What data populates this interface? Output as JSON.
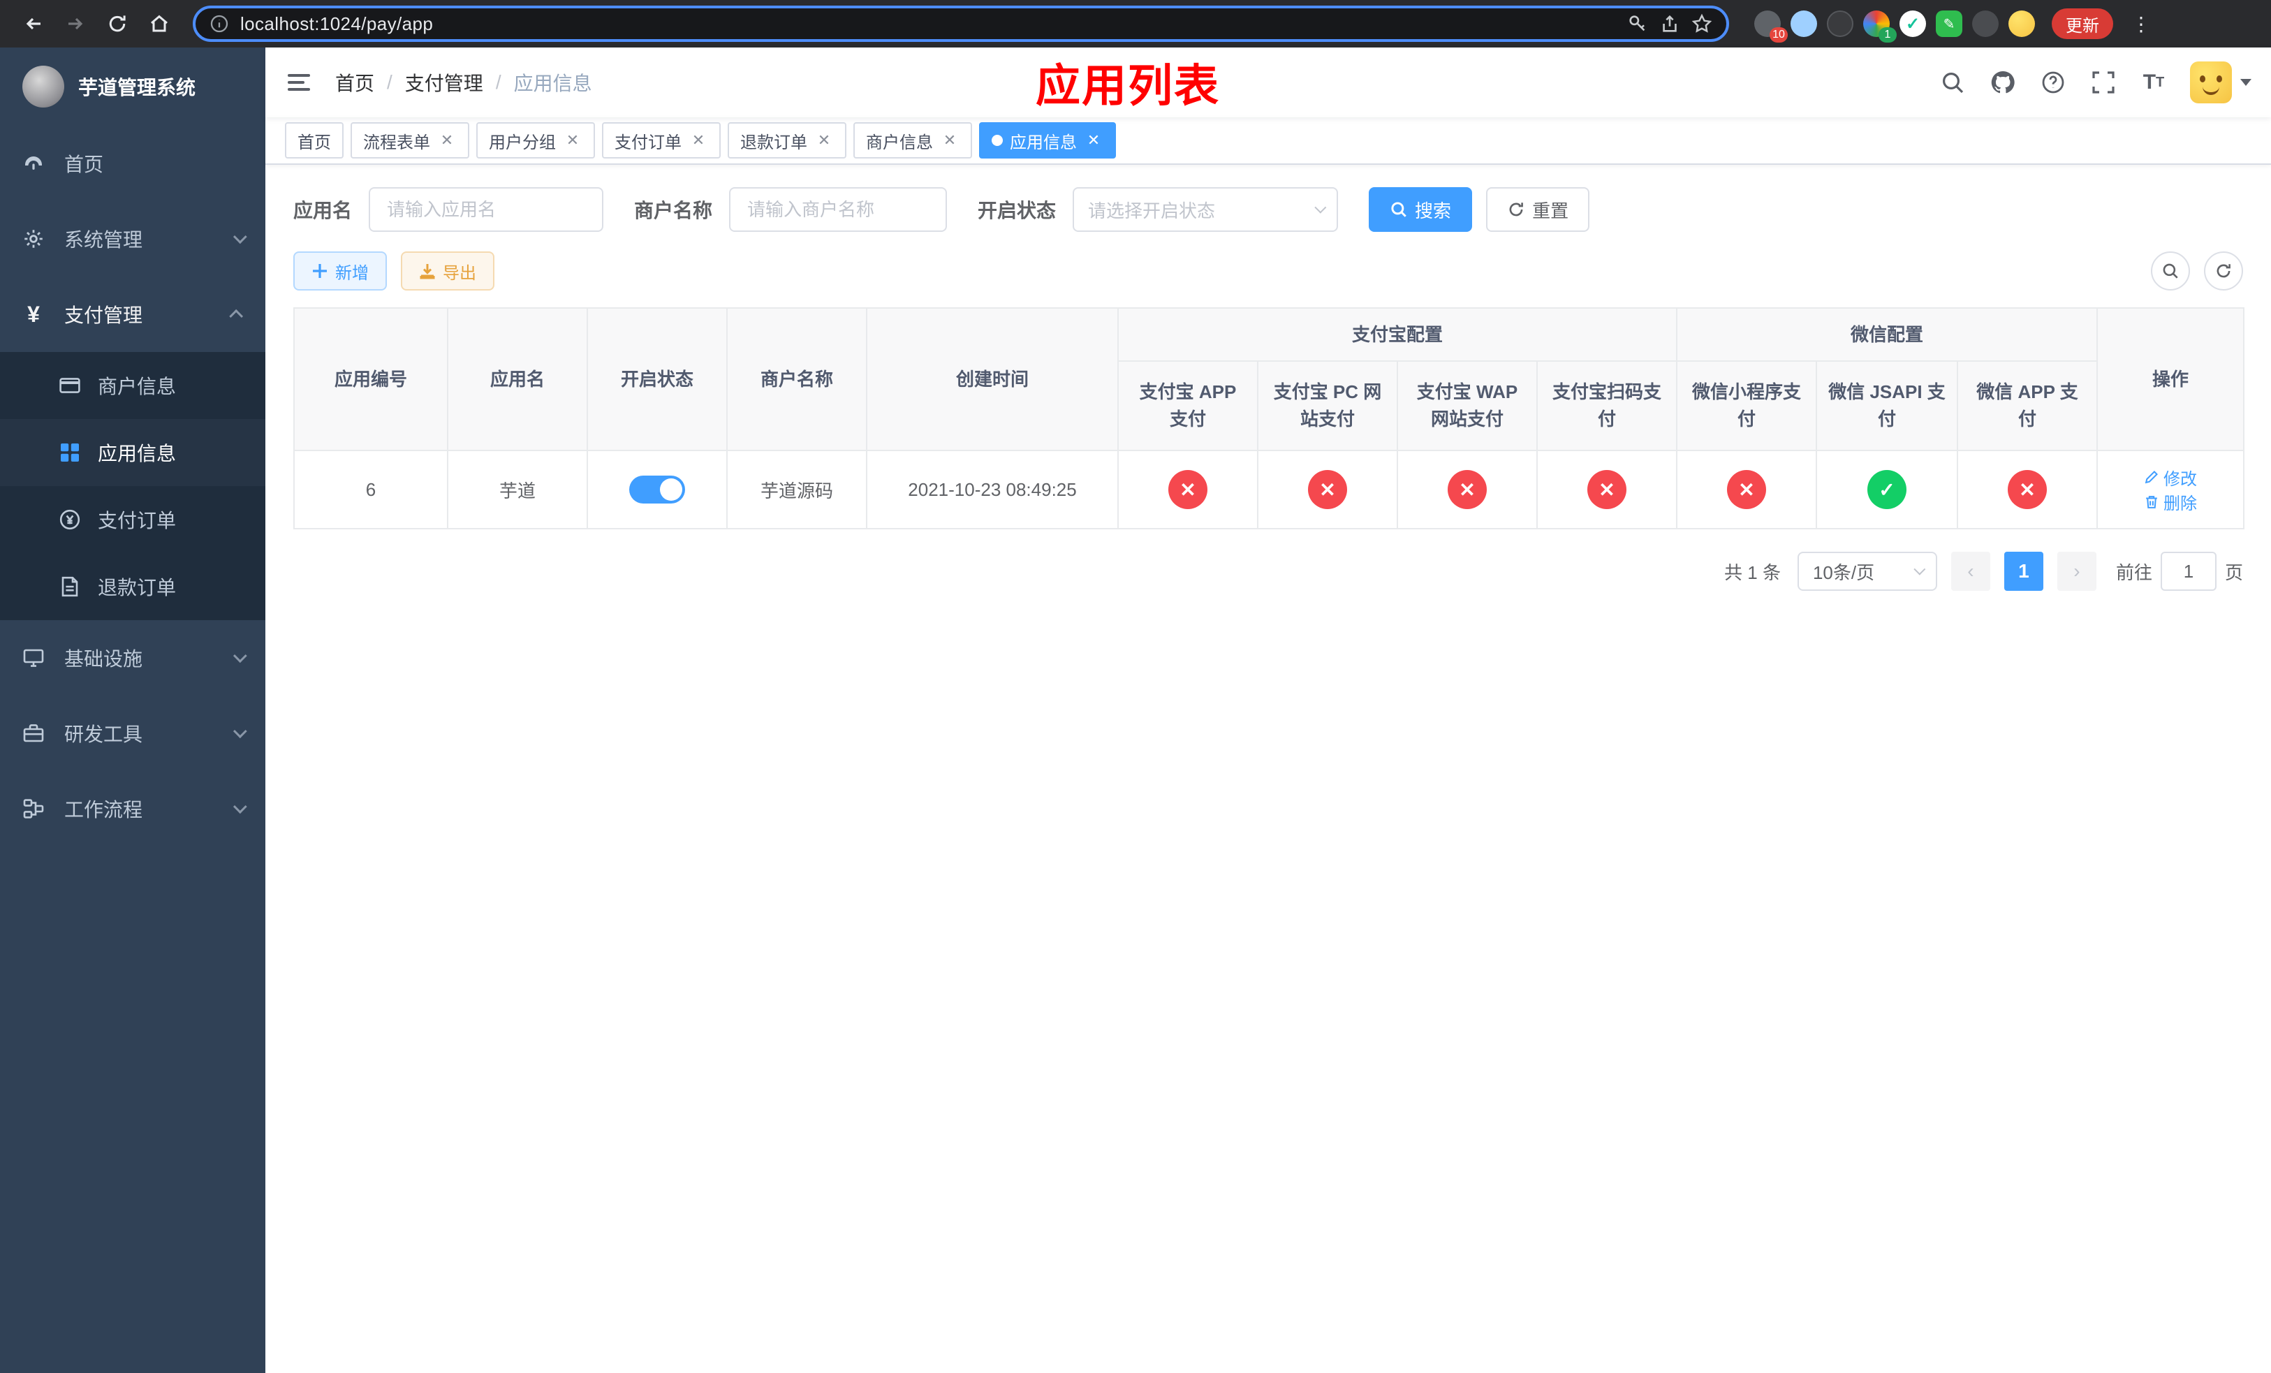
{
  "colors": {
    "primary": "#409eff",
    "success": "#13ce66",
    "danger": "#f5484e",
    "warning": "#e6a23c",
    "sidebar_bg": "#304156",
    "submenu_bg": "#1f2d3d",
    "annotation_red": "#ff0000"
  },
  "browser": {
    "url": "localhost:1024/pay/app",
    "update_label": "更新",
    "ext_badge_puzzle": "10",
    "ext_badge_color": "1"
  },
  "sidebar": {
    "title": "芋道管理系统",
    "items": [
      {
        "label": "首页"
      },
      {
        "label": "系统管理"
      },
      {
        "label": "支付管理"
      },
      {
        "label": "基础设施"
      },
      {
        "label": "研发工具"
      },
      {
        "label": "工作流程"
      }
    ],
    "payment_children": [
      {
        "label": "商户信息"
      },
      {
        "label": "应用信息"
      },
      {
        "label": "支付订单"
      },
      {
        "label": "退款订单"
      }
    ]
  },
  "header": {
    "breadcrumb": [
      "首页",
      "支付管理",
      "应用信息"
    ],
    "overlay_title": "应用列表"
  },
  "tabs": [
    {
      "label": "首页"
    },
    {
      "label": "流程表单"
    },
    {
      "label": "用户分组"
    },
    {
      "label": "支付订单"
    },
    {
      "label": "退款订单"
    },
    {
      "label": "商户信息"
    },
    {
      "label": "应用信息"
    }
  ],
  "filters": {
    "app_name_label": "应用名",
    "app_name_placeholder": "请输入应用名",
    "merchant_label": "商户名称",
    "merchant_placeholder": "请输入商户名称",
    "status_label": "开启状态",
    "status_placeholder": "请选择开启状态",
    "search_label": "搜索",
    "reset_label": "重置"
  },
  "toolbar": {
    "add_label": "新增",
    "export_label": "导出"
  },
  "table": {
    "columns": [
      "应用编号",
      "应用名",
      "开启状态",
      "商户名称",
      "创建时间",
      "操作"
    ],
    "alipay_group": "支付宝配置",
    "alipay_cols": [
      "支付宝 APP 支付",
      "支付宝 PC 网站支付",
      "支付宝 WAP 网站支付",
      "支付宝扫码支付"
    ],
    "wechat_group": "微信配置",
    "wechat_cols": [
      "微信小程序支付",
      "微信 JSAPI 支付",
      "微信 APP 支付"
    ],
    "row": {
      "id": "6",
      "name": "芋道",
      "status_on": true,
      "merchant": "芋道源码",
      "created": "2021-10-23 08:49:25",
      "configs": [
        "no",
        "no",
        "no",
        "no",
        "no",
        "yes",
        "no"
      ],
      "edit": "修改",
      "delete": "删除"
    }
  },
  "pagination": {
    "total": "共 1 条",
    "size": "10条/页",
    "page": "1",
    "goto_label": "前往",
    "goto_value": "1",
    "unit": "页"
  }
}
